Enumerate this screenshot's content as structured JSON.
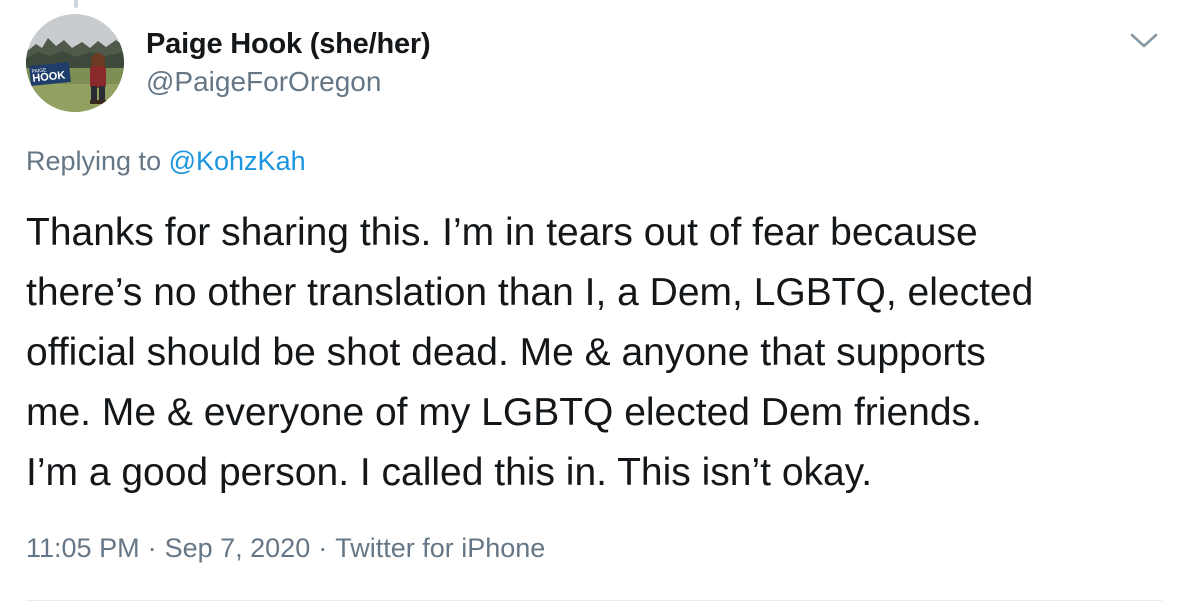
{
  "tweet": {
    "author": {
      "display_name": "Paige Hook (she/her)",
      "handle": "@PaigeForOregon",
      "avatar_sign_text": "HOOK",
      "avatar_sign_small": "PAIGE"
    },
    "reply_context": {
      "prefix": "Replying to",
      "mention": "@KohzKah"
    },
    "text_lines": [
      "Thanks for sharing this. I’m in tears out of fear because",
      "there’s no other translation than I, a Dem, LGBTQ, elected",
      "official should be shot dead. Me & anyone that supports",
      "me. Me & everyone of my LGBTQ elected Dem friends.",
      "I’m a good person. I called this in. This isn’t okay."
    ],
    "meta": {
      "time": "11:05 PM",
      "separator": "·",
      "date": "Sep 7, 2020",
      "source": "Twitter for iPhone"
    }
  },
  "icons": {
    "more_options": "chevron-down-icon"
  },
  "colors": {
    "text_primary": "#14171a",
    "text_secondary": "#657786",
    "link": "#1b95e0",
    "divider": "#e6ecf0",
    "thread_line": "#ccd6dd"
  }
}
